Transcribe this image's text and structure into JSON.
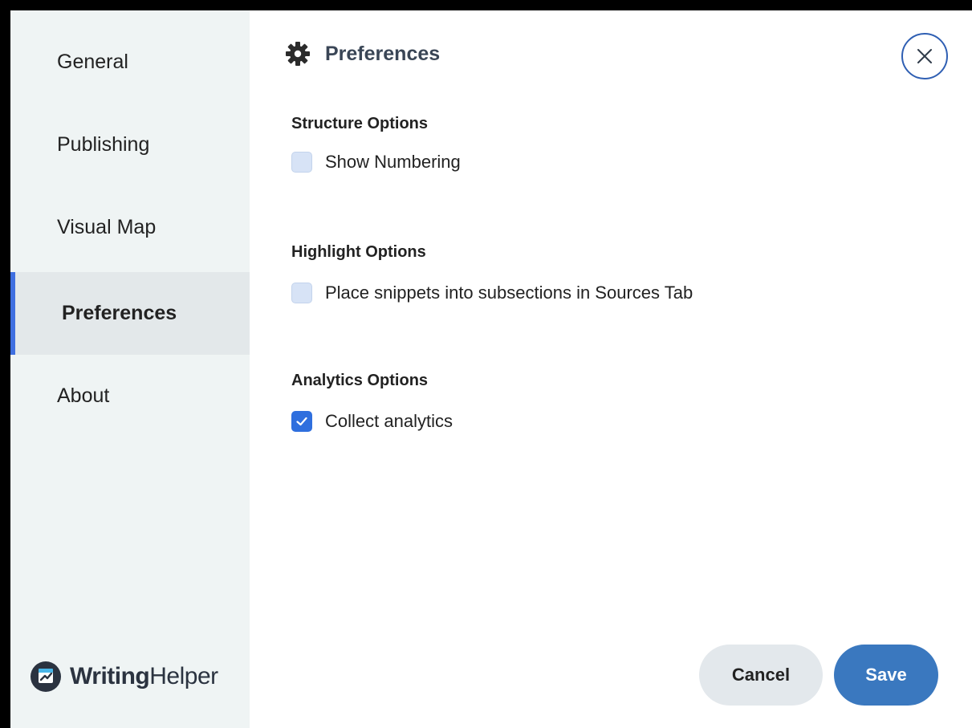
{
  "sidebar": {
    "items": [
      {
        "label": "General"
      },
      {
        "label": "Publishing"
      },
      {
        "label": "Visual Map"
      },
      {
        "label": "Preferences",
        "active": true
      },
      {
        "label": "About"
      }
    ],
    "brand": {
      "part1": "Writing",
      "part2": "Helper",
      "logo_icon": "writinghelper-logo-icon"
    }
  },
  "header": {
    "title": "Preferences",
    "icon": "gear-icon",
    "close_icon": "close-icon"
  },
  "sections": [
    {
      "heading": "Structure Options",
      "options": [
        {
          "label": "Show Numbering",
          "checked": false
        }
      ]
    },
    {
      "heading": "Highlight Options",
      "options": [
        {
          "label": "Place snippets into subsections in Sources Tab",
          "checked": false
        }
      ]
    },
    {
      "heading": "Analytics Options",
      "options": [
        {
          "label": "Collect analytics",
          "checked": true
        }
      ]
    }
  ],
  "buttons": {
    "cancel": "Cancel",
    "save": "Save"
  },
  "colors": {
    "accent": "#3f6fe0",
    "save_button": "#3a78bf",
    "sidebar_bg": "#eff4f4"
  }
}
